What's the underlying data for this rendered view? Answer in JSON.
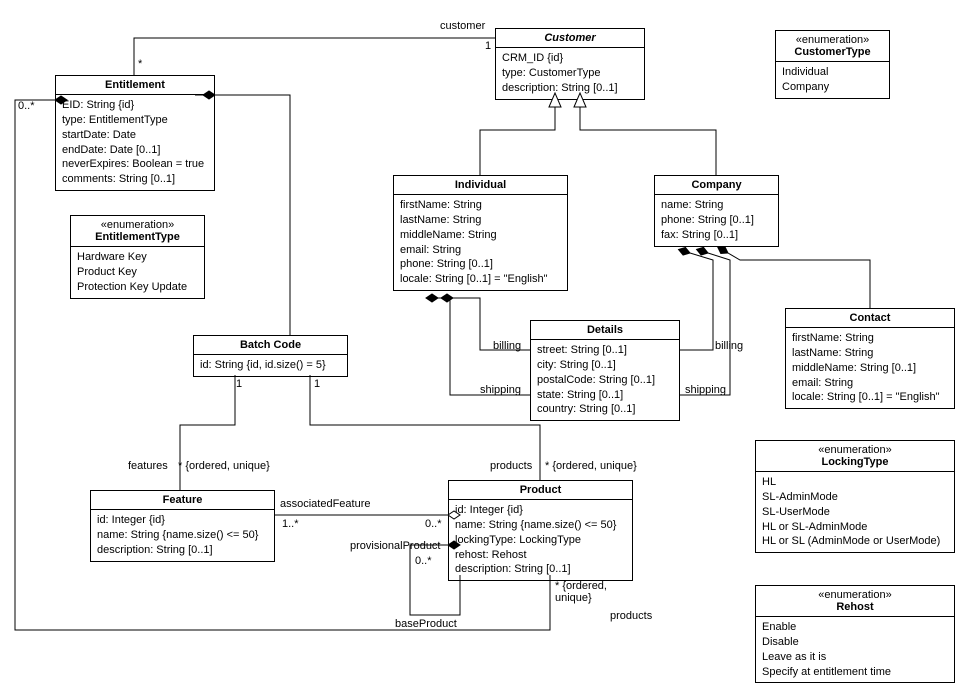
{
  "classes": {
    "entitlement": {
      "name": "Entitlement",
      "attrs": [
        "EID: String {id}",
        "type: EntitlementType",
        "startDate: Date",
        "endDate: Date [0..1]",
        "neverExpires: Boolean = true",
        "comments: String [0..1]"
      ]
    },
    "entitlementType": {
      "stereo": "«enumeration»",
      "name": "EntitlementType",
      "literals": [
        "Hardware Key",
        "Product Key",
        "Protection Key Update"
      ]
    },
    "batchCode": {
      "name": "Batch Code",
      "attrs": [
        "id: String {id, id.size() = 5}"
      ]
    },
    "feature": {
      "name": "Feature",
      "attrs": [
        "id: Integer {id}",
        "name: String {name.size() <= 50}",
        "description: String [0..1]"
      ]
    },
    "product": {
      "name": "Product",
      "attrs": [
        "id: Integer {id}",
        "name: String {name.size() <= 50}",
        "lockingType: LockingType",
        "rehost: Rehost",
        "description: String [0..1]"
      ]
    },
    "customer": {
      "name": "Customer",
      "italic": true,
      "attrs": [
        "CRM_ID {id}",
        "type: CustomerType",
        "description: String [0..1]"
      ]
    },
    "customerType": {
      "stereo": "«enumeration»",
      "name": "CustomerType",
      "literals": [
        "Individual",
        "Company"
      ]
    },
    "individual": {
      "name": "Individual",
      "attrs": [
        "firstName: String",
        "lastName: String",
        "middleName: String",
        "email: String",
        "phone: String [0..1]",
        "locale: String [0..1] = \"English\""
      ]
    },
    "company": {
      "name": "Company",
      "attrs": [
        "name: String",
        "phone: String [0..1]",
        "fax: String [0..1]"
      ]
    },
    "details": {
      "name": "Details",
      "attrs": [
        "street: String [0..1]",
        "city: String [0..1]",
        "postalCode: String [0..1]",
        "state: String [0..1]",
        "country: String [0..1]"
      ]
    },
    "contact": {
      "name": "Contact",
      "attrs": [
        "firstName: String",
        "lastName: String",
        "middleName: String [0..1]",
        "email: String",
        "locale: String [0..1] = \"English\""
      ]
    },
    "lockingType": {
      "stereo": "«enumeration»",
      "name": "LockingType",
      "literals": [
        "HL",
        "SL-AdminMode",
        "SL-UserMode",
        "HL or SL-AdminMode",
        "HL or SL (AdminMode or UserMode)"
      ]
    },
    "rehost": {
      "stereo": "«enumeration»",
      "name": "Rehost",
      "literals": [
        "Enable",
        "Disable",
        "Leave as it is",
        "Specify at entitlement time"
      ]
    }
  },
  "labels": {
    "customerRole": "customer",
    "customerMult1": "1",
    "customerMultStar": "*",
    "batch1a": "1",
    "batch1b": "1",
    "featuresRole": "features",
    "featuresMult": "* {ordered, unique}",
    "productsRole1": "products",
    "productsMult1": "* {ordered, unique}",
    "assocFeature": "associatedFeature",
    "assocFeatureMult": "1..*",
    "assocFeatureStar": "0..*",
    "provisionalProduct": "provisionalProduct",
    "provisionalMult": "0..*",
    "baseProduct": "baseProduct",
    "productsRole2": "products",
    "productsMult2": "* {ordered,\nunique}",
    "entProductsMult": "0..*",
    "billing1": "billing",
    "shipping1": "shipping",
    "billing2": "billing",
    "shipping2": "shipping"
  }
}
